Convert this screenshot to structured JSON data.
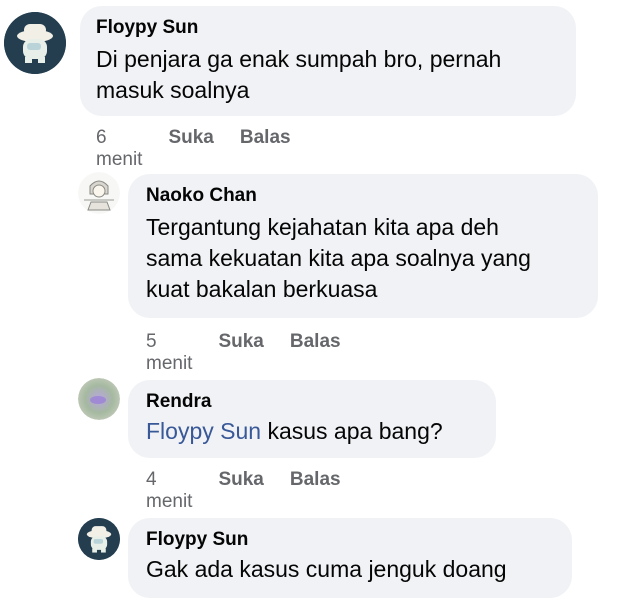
{
  "comments": [
    {
      "author": "Floypy Sun",
      "lines": [
        "Di penjara ga enak sumpah bro, pernah",
        "masuk soalnya"
      ],
      "time": "6 menit",
      "like": "Suka",
      "reply": "Balas",
      "avatar_icon": "crewmate-hat-avatar-icon"
    },
    {
      "author": "Naoko Chan",
      "lines": [
        "Tergantung kejahatan kita apa deh",
        "sama kekuatan kita apa soalnya yang",
        "kuat bakalan berkuasa"
      ],
      "time": "5 menit",
      "like": "Suka",
      "reply": "Balas",
      "avatar_icon": "anime-sketch-avatar-icon"
    },
    {
      "author": "Rendra",
      "mention": "Floypy Sun",
      "text_after_mention": " kasus apa bang?",
      "time": "4 menit",
      "like": "Suka",
      "reply": "Balas",
      "avatar_icon": "purple-blur-avatar-icon"
    },
    {
      "author": "Floypy Sun",
      "lines": [
        "Gak ada kasus cuma jenguk doang"
      ],
      "avatar_icon": "crewmate-hat-avatar-icon"
    }
  ],
  "colors": {
    "bubble": "#f0f2f5",
    "meta_text": "#65676b",
    "mention": "#385898",
    "avatar_dark": "#1f3a4a"
  }
}
